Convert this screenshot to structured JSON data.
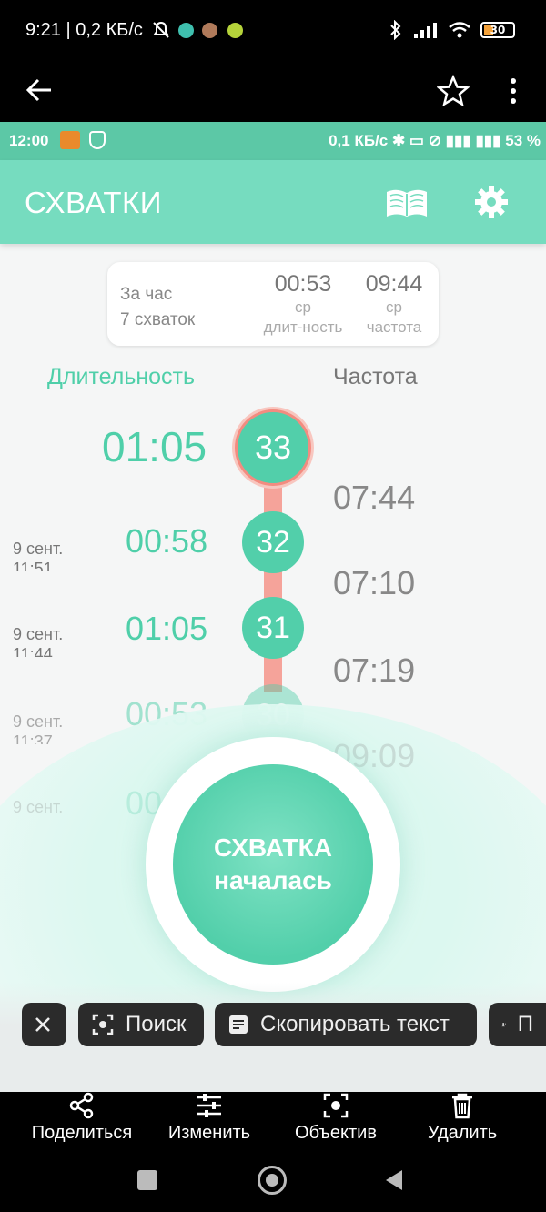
{
  "outer_status": {
    "time": "9:21 | 0,2 КБ/с",
    "battery": "30"
  },
  "inner_status": {
    "time": "12:00",
    "right": "0,1 КБ/с ✱  ▭  ⊘  ▮▮▮ ▮▮▮  53 %"
  },
  "app": {
    "title": "СХВАТКИ",
    "summary": {
      "hour_label": "За час",
      "count_label": "7 схваток",
      "avg_duration": "00:53",
      "avg_duration_l1": "ср",
      "avg_duration_l2": "длит-ность",
      "avg_frequency": "09:44",
      "avg_frequency_l1": "ср",
      "avg_frequency_l2": "частота"
    },
    "col_duration": "Длительность",
    "col_frequency": "Частота",
    "entries": [
      {
        "num": "33",
        "duration": "01:05",
        "date": "",
        "time": ""
      },
      {
        "num": "32",
        "duration": "00:58",
        "date": "9 сент.",
        "time": "11:51"
      },
      {
        "num": "31",
        "duration": "01:05",
        "date": "9 сент.",
        "time": "11:44"
      },
      {
        "num": "30",
        "duration": "00:53",
        "date": "9 сент.",
        "time": "11:37"
      },
      {
        "num": "",
        "duration": "00",
        "date": "9 сент.",
        "time": ""
      }
    ],
    "frequencies": [
      "07:44",
      "07:10",
      "07:19",
      "09:09"
    ],
    "start_button_line1": "СХВАТКА",
    "start_button_line2": "началась"
  },
  "chips": {
    "search": "Поиск",
    "copy": "Скопировать текст",
    "listen": "П"
  },
  "actions": {
    "share": "Поделиться",
    "edit": "Изменить",
    "lens": "Объектив",
    "delete": "Удалить"
  },
  "colors": {
    "accent": "#52cfaa",
    "app_bar": "#76dcbf",
    "link": "#f5a39a"
  }
}
